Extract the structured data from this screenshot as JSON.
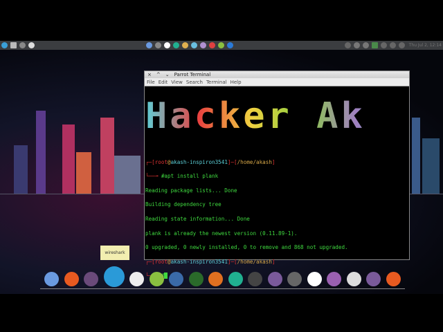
{
  "panel": {
    "clock": "Thu Jul 2, 12:14"
  },
  "terminal": {
    "title": "Parrot Terminal",
    "menu": [
      "File",
      "Edit",
      "View",
      "Search",
      "Terminal",
      "Help"
    ],
    "banner": "Hacker Ak",
    "lines": [
      {
        "user": "root",
        "host": "akash-inspiron3541",
        "path": "/home/akash"
      },
      {
        "cmd": "#apt install plank"
      },
      "Reading package lists... Done",
      "Building dependency tree",
      "Reading state information... Done",
      "plank is already the newest version (0.11.89-1).",
      "0 upgraded, 0 newly installed, 0 to remove and 868 not upgraded."
    ],
    "prompt2": {
      "user": "root",
      "host": "akash-inspiron3541",
      "path": "/home/akash",
      "cmd": "#"
    }
  },
  "tooltip": "wireshark",
  "dock": [
    {
      "name": "chromium",
      "color": "#6a9ae0"
    },
    {
      "name": "firefox",
      "color": "#e85a20"
    },
    {
      "name": "tor-browser",
      "color": "#6a4a7a"
    },
    {
      "name": "wireshark",
      "color": "#2a9ad8"
    },
    {
      "name": "chess",
      "color": "#eeeeee"
    },
    {
      "name": "image-viewer",
      "color": "#8ac040"
    },
    {
      "name": "mail",
      "color": "#3a6aa8"
    },
    {
      "name": "system-monitor",
      "color": "#2a6a2a"
    },
    {
      "name": "burpsuite",
      "color": "#e07020"
    },
    {
      "name": "activity-monitor",
      "color": "#20b090"
    },
    {
      "name": "terminal",
      "color": "#444444"
    },
    {
      "name": "files",
      "color": "#7a5a9a"
    },
    {
      "name": "trash",
      "color": "#666666"
    },
    {
      "name": "app-coral",
      "color": "#ffffff"
    },
    {
      "name": "text-editor",
      "color": "#9a60b0"
    },
    {
      "name": "clock",
      "color": "#dddddd"
    },
    {
      "name": "folder",
      "color": "#7a5a9a"
    },
    {
      "name": "firefox-2",
      "color": "#e85a20"
    }
  ]
}
